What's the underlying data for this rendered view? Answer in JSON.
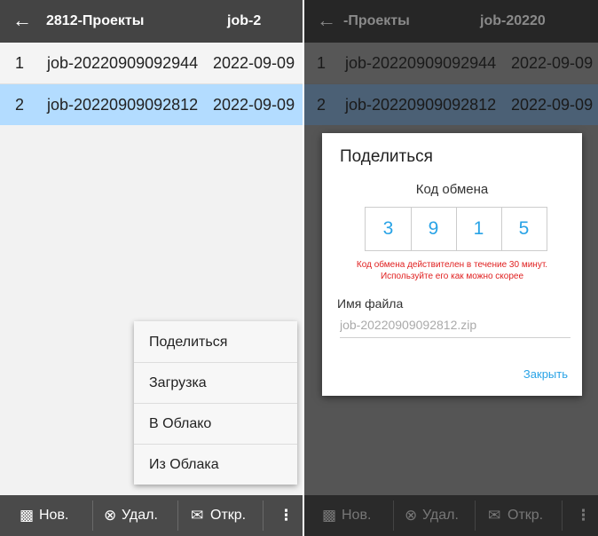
{
  "left": {
    "header": {
      "back_icon": "arrow-left-icon",
      "title": "2812-Проекты",
      "title2": "job-2"
    },
    "rows": [
      {
        "num": "1",
        "name": "job-20220909092944",
        "date": "2022-09-09"
      },
      {
        "num": "2",
        "name": "job-20220909092812",
        "date": "2022-09-09"
      }
    ],
    "menu": {
      "items": [
        "Поделиться",
        "Загрузка",
        "В Облако",
        "Из Облака"
      ]
    },
    "bottombar": {
      "new_label": "Нов.",
      "delete_label": "Удал.",
      "open_label": "Откр."
    }
  },
  "right": {
    "header": {
      "back_icon": "arrow-left-icon",
      "title": "-Проекты",
      "title2": "job-20220"
    },
    "rows": [
      {
        "num": "1",
        "name": "job-20220909092944",
        "date": "2022-09-09"
      },
      {
        "num": "2",
        "name": "job-20220909092812",
        "date": "2022-09-09"
      }
    ],
    "dialog": {
      "title": "Поделиться",
      "code_label": "Код обмена",
      "code_digits": [
        "3",
        "9",
        "1",
        "5"
      ],
      "warning_line1": "Код обмена действителен в течение 30 минут.",
      "warning_line2": "Используйте его как можно скорее",
      "filename_label": "Имя файла",
      "filename_value": "job-20220909092812.zip",
      "close_label": "Закрыть"
    },
    "bottombar": {
      "new_label": "Нов.",
      "delete_label": "Удал.",
      "open_label": "Откр."
    }
  },
  "colors": {
    "accent": "#29a3e6",
    "selected_row": "#b3dcff",
    "warning": "#e02020",
    "toolbar": "#444444"
  }
}
